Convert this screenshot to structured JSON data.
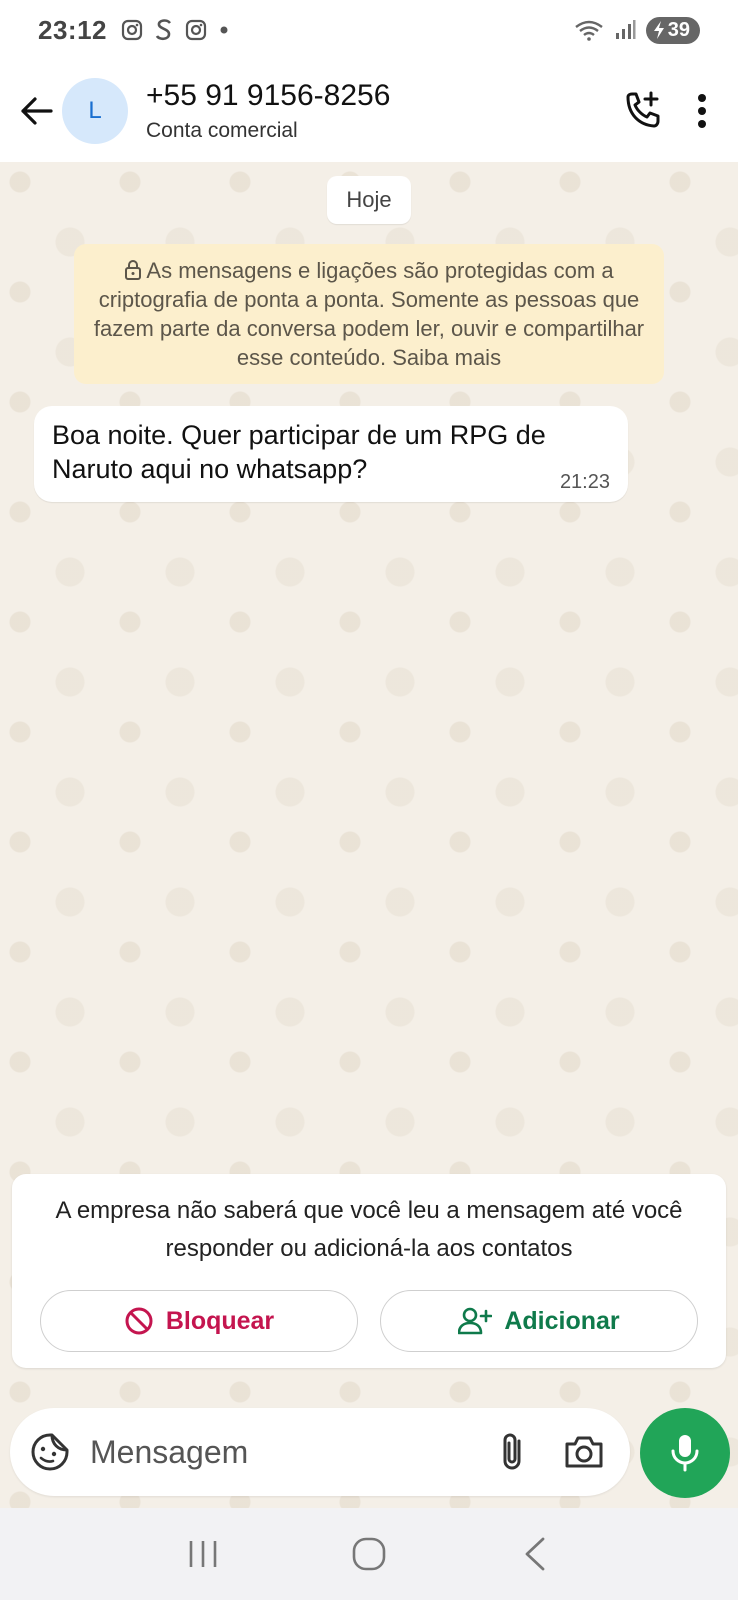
{
  "status_bar": {
    "time": "23:12",
    "battery": "39",
    "left_icons": [
      "instagram-icon",
      "s-app-icon",
      "instagram-icon",
      "dot-icon"
    ],
    "right_icons": [
      "wifi-icon",
      "signal-icon",
      "battery-charging-icon"
    ]
  },
  "header": {
    "avatar_letter": "L",
    "contact_name": "+55 91 9156-8256",
    "contact_subtitle": "Conta comercial"
  },
  "chat": {
    "date_label": "Hoje",
    "encryption_notice": "As mensagens e ligações são protegidas com a criptografia de ponta a ponta. Somente as pessoas que fazem parte da conversa podem ler, ouvir e compartilhar esse conteúdo. Saiba mais",
    "messages": [
      {
        "text": "Boa noite. Quer participar de um RPG de Naruto aqui no whatsapp?",
        "time": "21:23"
      }
    ]
  },
  "business_card": {
    "text": "A empresa não saberá que você leu a mensagem até você responder ou adicioná-la aos contatos",
    "block_label": "Bloquear",
    "add_label": "Adicionar"
  },
  "composer": {
    "placeholder": "Mensagem"
  },
  "colors": {
    "accent_green": "#21a558",
    "block_red": "#c4154f",
    "add_green": "#0f7a4b",
    "notice_bg": "#fcefcd",
    "chat_bg": "#f4efe7"
  }
}
